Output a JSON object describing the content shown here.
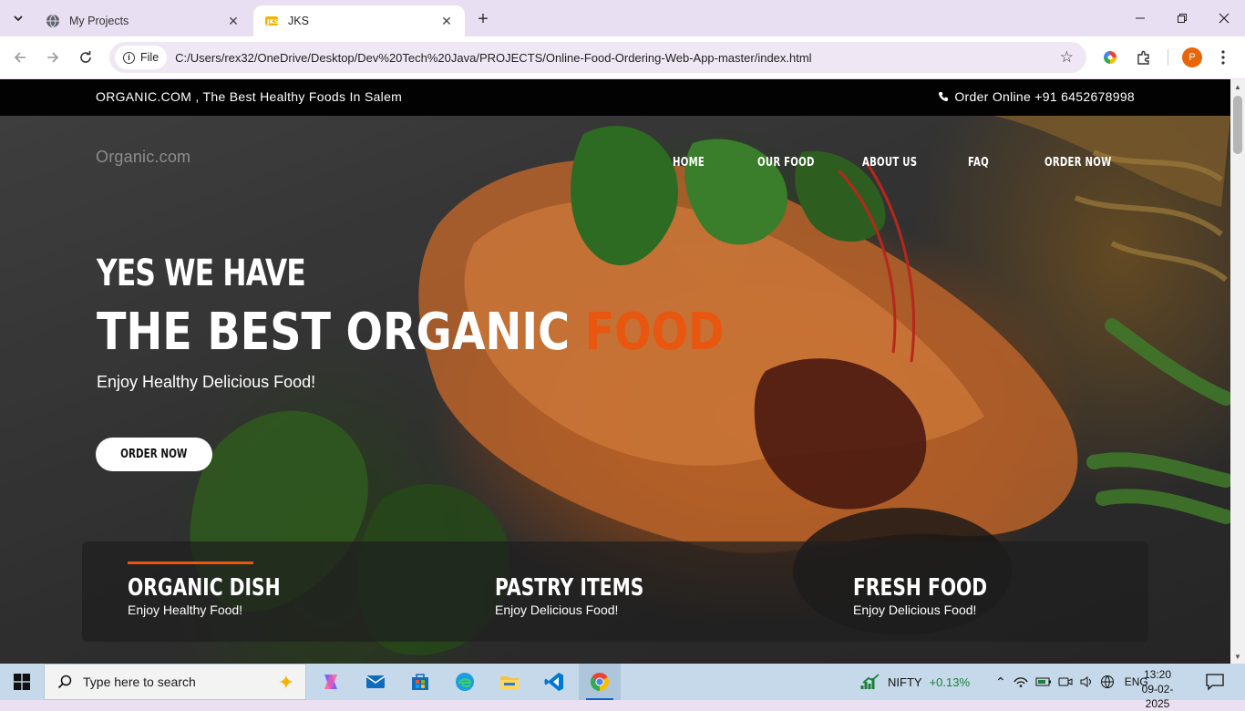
{
  "browser": {
    "tabs": [
      {
        "title": "My Projects",
        "active": false
      },
      {
        "title": "JKS",
        "active": true
      }
    ],
    "site_chip_label": "File",
    "url": "C:/Users/rex32/OneDrive/Desktop/Dev%20Tech%20Java/PROJECTS/Online-Food-Ordering-Web-App-master/index.html",
    "profile_initial": "P"
  },
  "page": {
    "topbar": {
      "left_text": "ORGANIC.COM , The Best Healthy Foods In Salem",
      "right_text": "Order Online +91 6452678998"
    },
    "logo": "Organic.com",
    "menu": [
      "HOME",
      "OUR FOOD",
      "ABOUT US",
      "FAQ",
      "ORDER NOW"
    ],
    "hero": {
      "line1": "YES WE HAVE",
      "line2_main": "THE BEST ORGANIC",
      "line2_accent": "FOOD",
      "tagline": "Enjoy Healthy Delicious Food!",
      "button": "ORDER NOW"
    },
    "features": [
      {
        "title": "ORGANIC DISH",
        "subtitle": "Enjoy Healthy Food!"
      },
      {
        "title": "PASTRY ITEMS",
        "subtitle": "Enjoy Delicious Food!"
      },
      {
        "title": "FRESH FOOD",
        "subtitle": "Enjoy Delicious Food!"
      }
    ],
    "colors": {
      "accent": "#e8560f",
      "topbar_bg": "#020202"
    }
  },
  "taskbar": {
    "search_placeholder": "Type here to search",
    "apps": [
      "copilot-icon",
      "mail-icon",
      "store-icon",
      "edge-icon",
      "file-explorer-icon",
      "vscode-icon",
      "chrome-icon"
    ],
    "stock": {
      "name": "NIFTY",
      "change": "+0.13%"
    },
    "language": "ENG",
    "time": "13:20",
    "date": "09-02-2025"
  }
}
